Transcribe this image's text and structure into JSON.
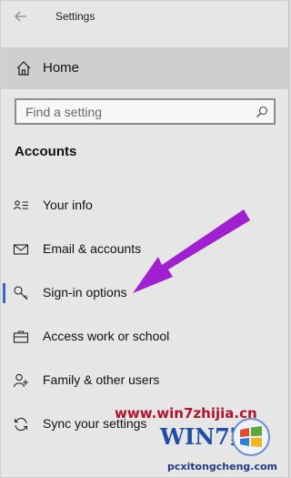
{
  "window": {
    "title": "Settings"
  },
  "nav": {
    "home_label": "Home",
    "search": {
      "placeholder": "Find a setting"
    },
    "section_title": "Accounts",
    "items": [
      {
        "label": "Your info",
        "icon": "person-card-icon",
        "selected": false
      },
      {
        "label": "Email & accounts",
        "icon": "mail-icon",
        "selected": false
      },
      {
        "label": "Sign-in options",
        "icon": "key-icon",
        "selected": true
      },
      {
        "label": "Access work or school",
        "icon": "briefcase-icon",
        "selected": false
      },
      {
        "label": "Family & other users",
        "icon": "person-add-icon",
        "selected": false
      },
      {
        "label": "Sync your settings",
        "icon": "sync-icon",
        "selected": false
      }
    ]
  },
  "annotation": {
    "color": "#a01fd0"
  },
  "watermark": {
    "url": "www.win7zhijia.cn",
    "brand": "WIN7家",
    "sub": "pcxitongcheng.com"
  },
  "colors": {
    "background": "#e6e6e6",
    "selected_bg": "#cfcfcf",
    "accent": "#3a66c7"
  }
}
